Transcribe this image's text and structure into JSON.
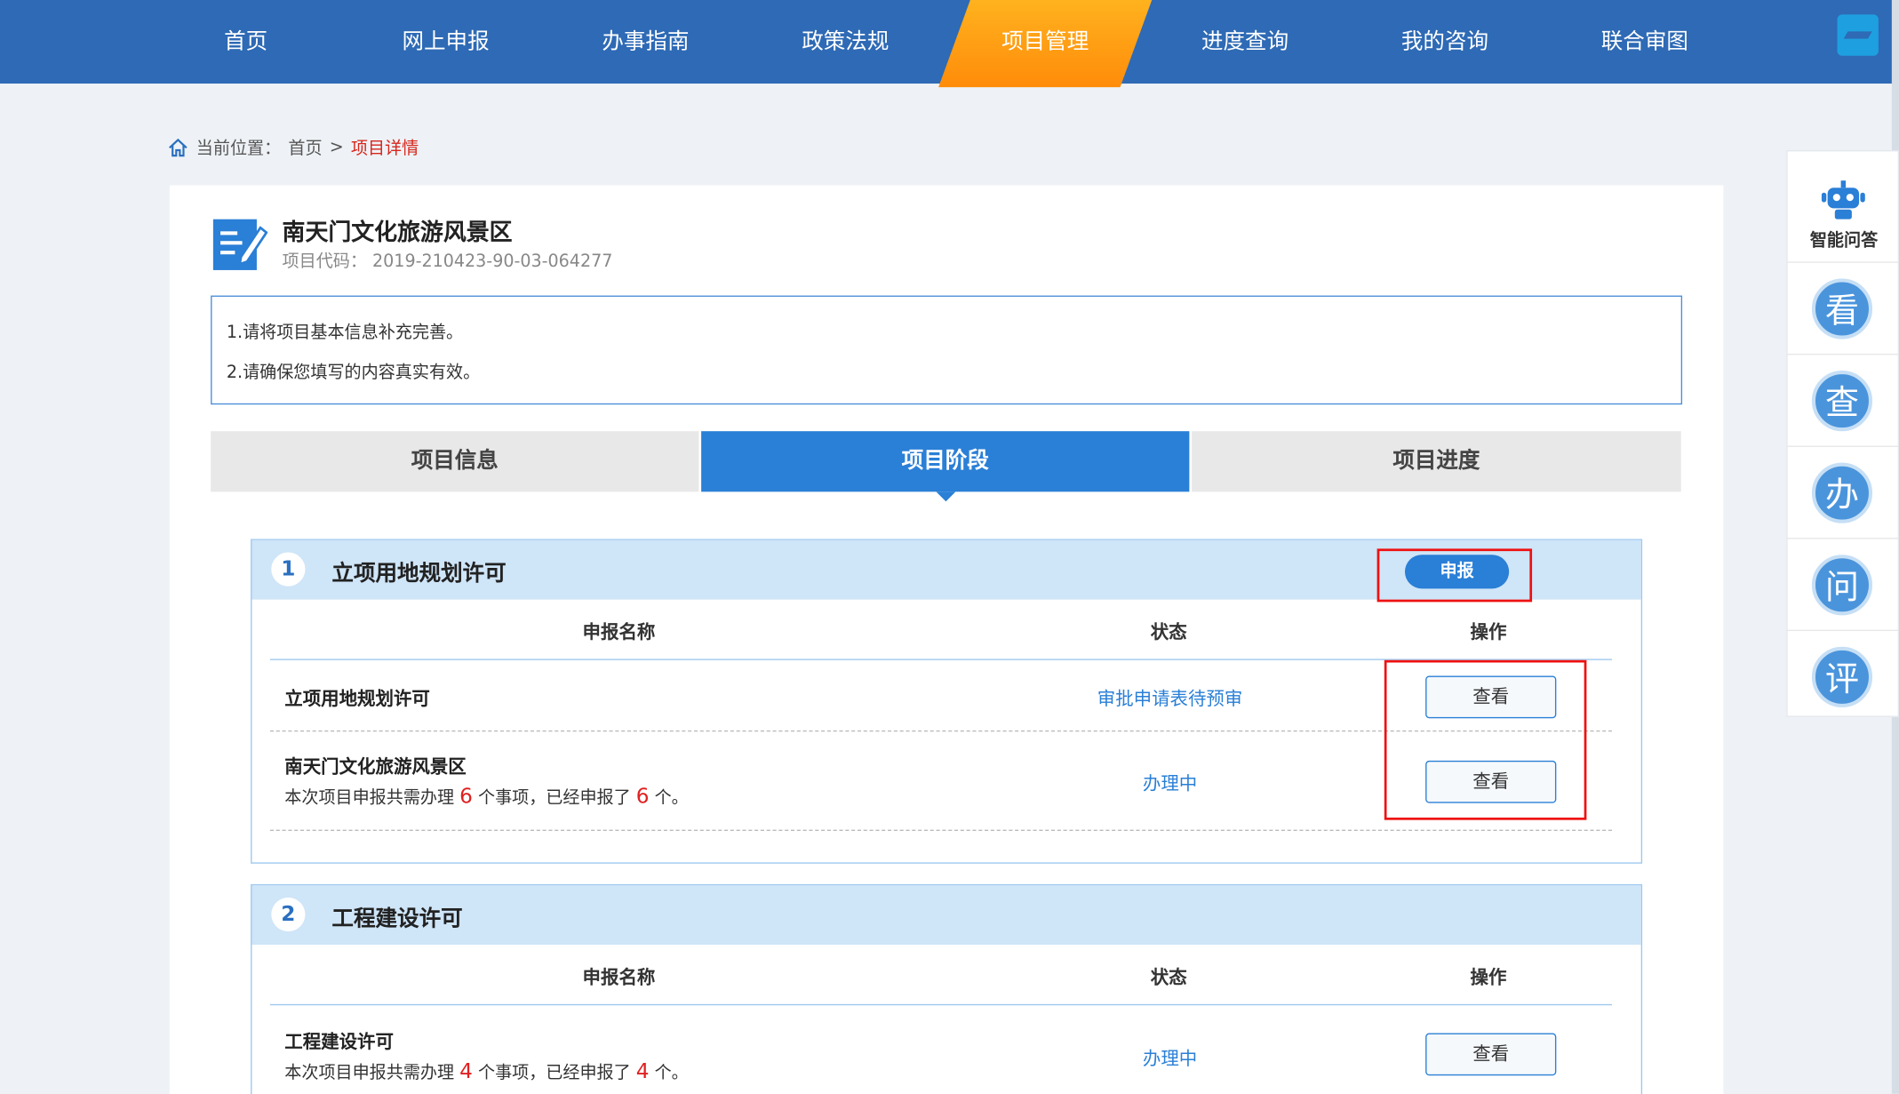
{
  "nav": {
    "items": [
      "首页",
      "网上申报",
      "办事指南",
      "政策法规",
      "项目管理",
      "进度查询",
      "我的咨询",
      "联合审图"
    ],
    "active": "项目管理"
  },
  "breadcrumb": {
    "label": "当前位置：",
    "home": "首页",
    "sep": ">",
    "current": "项目详情"
  },
  "project": {
    "title": "南天门文化旅游风景区",
    "code_label": "项目代码：",
    "code": "2019-210423-90-03-064277"
  },
  "notice": {
    "line1": "1.请将项目基本信息补充完善。",
    "line2": "2.请确保您填写的内容真实有效。"
  },
  "tabs": [
    "项目信息",
    "项目阶段",
    "项目进度"
  ],
  "table_headers": {
    "name": "申报名称",
    "status": "状态",
    "action": "操作"
  },
  "stages": [
    {
      "num": "1",
      "title": "立项用地规划许可",
      "apply_label": "申报",
      "rows": [
        {
          "name": "立项用地规划许可",
          "status": "审批申请表待预审",
          "action": "查看"
        },
        {
          "name": "南天门文化旅游风景区",
          "sub_pre": "本次项目申报共需办理",
          "total": "6",
          "sub_mid": "个事项，已经申报了",
          "done": "6",
          "sub_post": "个。",
          "status": "办理中",
          "action": "查看"
        }
      ]
    },
    {
      "num": "2",
      "title": "工程建设许可",
      "rows": [
        {
          "name": "工程建设许可",
          "sub_pre": "本次项目申报共需办理",
          "total": "4",
          "sub_mid": "个事项，已经申报了",
          "done": "4",
          "sub_post": "个。",
          "status": "办理中",
          "action": "查看"
        }
      ]
    }
  ],
  "side": {
    "robot_label": "智能问答",
    "items": [
      "看",
      "查",
      "办",
      "问",
      "评"
    ]
  },
  "colors": {
    "nav": "#2e6ab5",
    "active_tab": "#2a7fd6",
    "accent_orange": "#ff9a12",
    "highlight_red": "#e11111"
  }
}
